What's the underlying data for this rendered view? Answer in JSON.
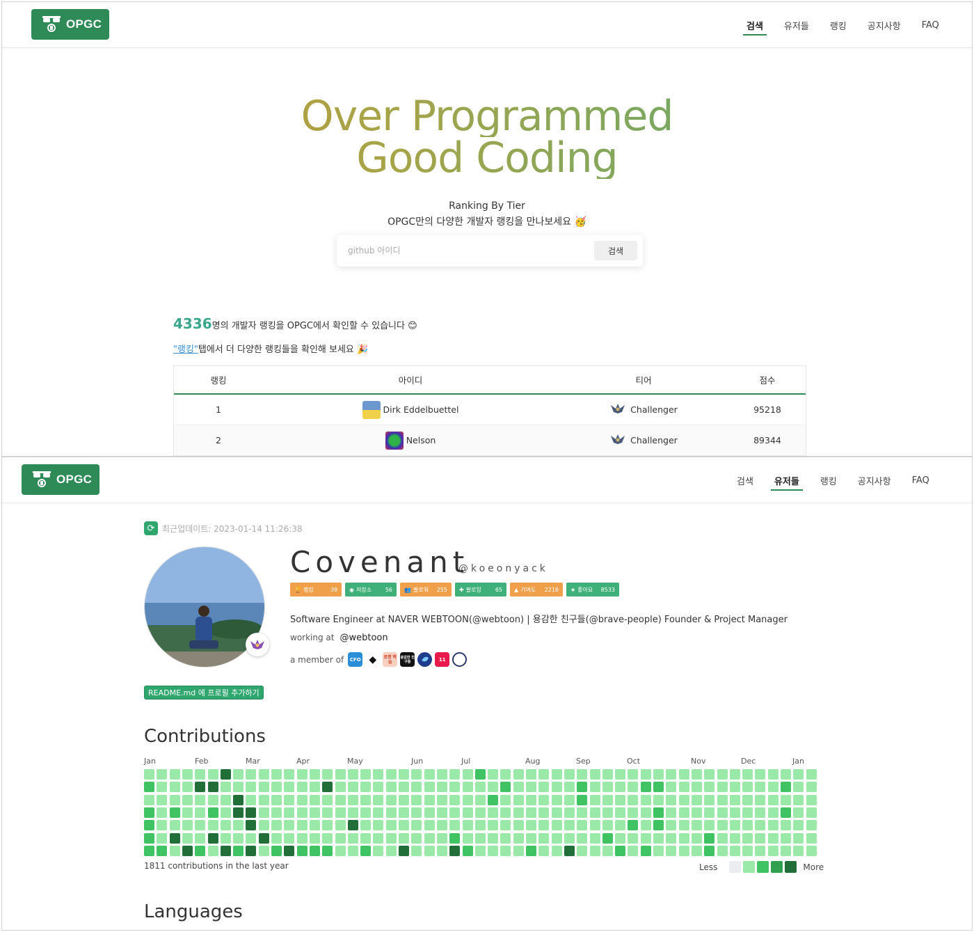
{
  "brand": {
    "name": "OPGC"
  },
  "nav": {
    "items": [
      "검색",
      "유저들",
      "랭킹",
      "공지사항",
      "FAQ"
    ]
  },
  "hero": {
    "title_line1": "Over Programmed",
    "title_line2": "Good Coding",
    "subtitle1": "Ranking By Tier",
    "subtitle2": "OPGC만의 다양한 개발자 랭킹을 만나보세요 🥳"
  },
  "search": {
    "placeholder": "github 아이디",
    "button": "검색"
  },
  "stats": {
    "count": "4336",
    "count_text": "명의 개발자 랭킹을 OPGC에서 확인할 수 있습니다 😊",
    "link_text": "\"랭킹\"",
    "link_suffix": "탭에서 더 다양한 랭킹들을 확인해 보세요 🎉"
  },
  "ranking_table": {
    "headers": [
      "랭킹",
      "아이디",
      "티어",
      "점수"
    ],
    "rows": [
      {
        "rank": "1",
        "id": "Dirk Eddelbuettel",
        "tier": "Challenger",
        "score": "95218"
      },
      {
        "rank": "2",
        "id": "Nelson",
        "tier": "Challenger",
        "score": "89344"
      }
    ]
  },
  "profile": {
    "updated": "최근업데이트: 2023-01-14 11:26:38",
    "name": "Covenant",
    "handle": "@koeonyack",
    "badges": [
      {
        "label": "랭킹",
        "value": "39",
        "color": "#f0a04b",
        "icon": "trophy-icon"
      },
      {
        "label": "저장소",
        "value": "56",
        "color": "#3fb07a",
        "icon": "repo-icon"
      },
      {
        "label": "팔로워",
        "value": "255",
        "color": "#f0a04b",
        "icon": "people-icon"
      },
      {
        "label": "팔로잉",
        "value": "65",
        "color": "#3fb07a",
        "icon": "follow-icon"
      },
      {
        "label": "기여도",
        "value": "2218",
        "color": "#f0a04b",
        "icon": "contrib-icon"
      },
      {
        "label": "좋아요",
        "value": "8533",
        "color": "#3fb07a",
        "icon": "star-icon"
      }
    ],
    "bio": "Software Engineer at NAVER WEBTOON(@webtoon) | 용감한 친구들(@brave-people) Founder & Project Manager",
    "working_label": "working at",
    "working_org": "@webtoon",
    "member_label": "a member of",
    "orgs": [
      {
        "name": "org-1",
        "color": "#2b8fd8",
        "text": "CFO"
      },
      {
        "name": "org-2",
        "color": "#ffffff",
        "text": "◆"
      },
      {
        "name": "org-3",
        "color": "#f7d0c0",
        "text": "로켓 학습"
      },
      {
        "name": "org-4",
        "color": "#111111",
        "text": "용감한 친구들"
      },
      {
        "name": "org-5",
        "color": "#1f3d8a",
        "text": ""
      },
      {
        "name": "org-6",
        "color": "#e8194b",
        "text": "11"
      },
      {
        "name": "org-7",
        "color": "#ffffff",
        "text": ""
      }
    ],
    "readme_button": "README.md 에 프로필 추가하기"
  },
  "contributions": {
    "title": "Contributions",
    "months": [
      "Jan",
      "Feb",
      "Mar",
      "Apr",
      "May",
      "Jun",
      "Jul",
      "Aug",
      "Sep",
      "Oct",
      "Nov",
      "Dec",
      "Jan"
    ],
    "total_text": "1811 contributions in the last year",
    "legend_less": "Less",
    "legend_more": "More",
    "colors": [
      "#ebedf0",
      "#9be9a8",
      "#40c463",
      "#30a14e",
      "#216e39"
    ],
    "dark_cells": [
      [
        6,
        0
      ],
      [
        4,
        1
      ],
      [
        5,
        1
      ],
      [
        14,
        1
      ],
      [
        7,
        2
      ],
      [
        7,
        3
      ],
      [
        8,
        3
      ],
      [
        8,
        4
      ],
      [
        16,
        4
      ],
      [
        8,
        6
      ],
      [
        11,
        6
      ],
      [
        6,
        6
      ],
      [
        20,
        6
      ],
      [
        24,
        6
      ],
      [
        33,
        6
      ],
      [
        9,
        5
      ],
      [
        5,
        5
      ],
      [
        2,
        5
      ],
      [
        3,
        6
      ]
    ],
    "mid_cells": [
      [
        6,
        0
      ],
      [
        26,
        0
      ],
      [
        0,
        1
      ],
      [
        4,
        1
      ],
      [
        5,
        1
      ],
      [
        28,
        1
      ],
      [
        34,
        1
      ],
      [
        39,
        1
      ],
      [
        40,
        1
      ],
      [
        50,
        1
      ],
      [
        7,
        2
      ],
      [
        27,
        2
      ],
      [
        34,
        2
      ],
      [
        0,
        3
      ],
      [
        2,
        3
      ],
      [
        5,
        3
      ],
      [
        7,
        3
      ],
      [
        8,
        3
      ],
      [
        40,
        3
      ],
      [
        50,
        3
      ],
      [
        0,
        4
      ],
      [
        8,
        4
      ],
      [
        16,
        4
      ],
      [
        38,
        4
      ],
      [
        40,
        4
      ],
      [
        0,
        5
      ],
      [
        2,
        5
      ],
      [
        5,
        5
      ],
      [
        24,
        5
      ],
      [
        36,
        5
      ],
      [
        44,
        5
      ],
      [
        0,
        6
      ],
      [
        1,
        6
      ],
      [
        3,
        6
      ],
      [
        4,
        6
      ],
      [
        6,
        6
      ],
      [
        7,
        6
      ],
      [
        10,
        6
      ],
      [
        11,
        6
      ],
      [
        12,
        6
      ],
      [
        13,
        6
      ],
      [
        14,
        6
      ],
      [
        17,
        6
      ],
      [
        20,
        6
      ],
      [
        24,
        6
      ],
      [
        25,
        6
      ],
      [
        30,
        6
      ],
      [
        37,
        6
      ],
      [
        39,
        6
      ],
      [
        44,
        6
      ]
    ]
  },
  "languages": {
    "title": "Languages"
  }
}
